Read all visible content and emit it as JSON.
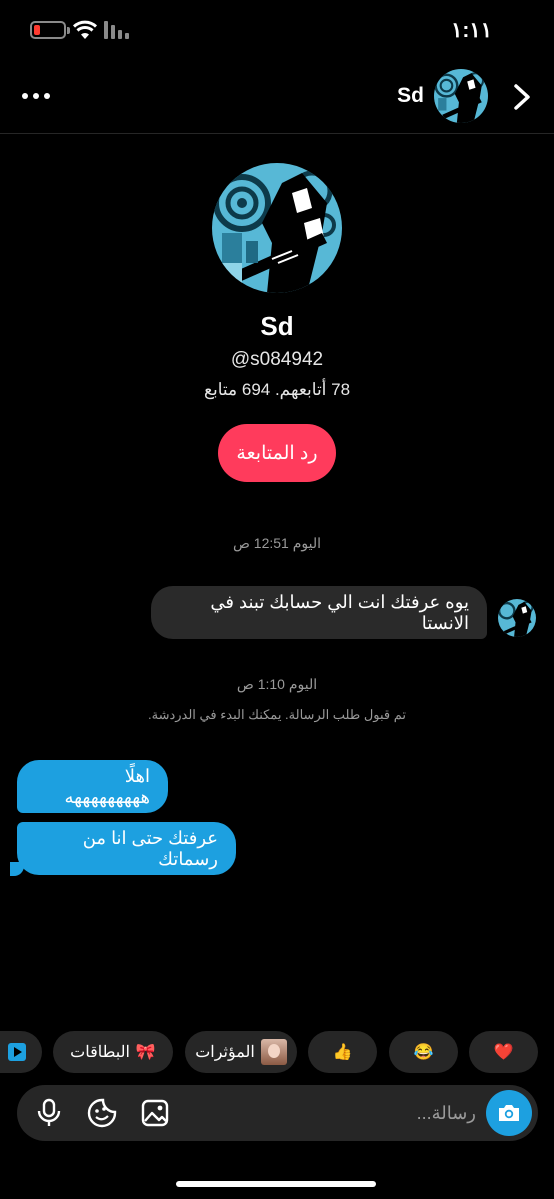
{
  "status_bar": {
    "time": "١:١١",
    "battery_color": "#ff3b30",
    "wifi_icon": "wifi-icon",
    "signal_icon": "signal-icon"
  },
  "header": {
    "name": "Sd",
    "back_icon": "chevron-right-icon",
    "more_icon": "more-dots-icon"
  },
  "profile": {
    "name": "Sd",
    "handle": "@s084942",
    "stats": "78 أتابعهم. 694 متابع",
    "follow_back_label": "رد المتابعة",
    "follow_back_color": "#ff3b5c"
  },
  "conversation": {
    "timestamp_1": "اليوم 12:51 ص",
    "incoming_message": "يوه عرفتك انت الي حسابك تبند في الانستا",
    "timestamp_2": "اليوم 1:10 ص",
    "system_note": "تم قبول طلب الرسالة. يمكنك البدء في الدردشة.",
    "outgoing_messages": [
      "اهلًا هههههههههه",
      "عرفتك حتى انا من رسماتك"
    ],
    "outgoing_color": "#1da0e0"
  },
  "quick_replies": {
    "cards_label": "البطاقات",
    "cards_icon": "🎀",
    "stickers_label": "المؤثرات",
    "like": "👍",
    "laugh": "😂",
    "heart": "❤️"
  },
  "composer": {
    "placeholder": "رسالة...",
    "camera_icon": "camera-icon",
    "mic_icon": "mic-icon",
    "sticker_icon": "sticker-icon",
    "gallery_icon": "gallery-icon"
  }
}
